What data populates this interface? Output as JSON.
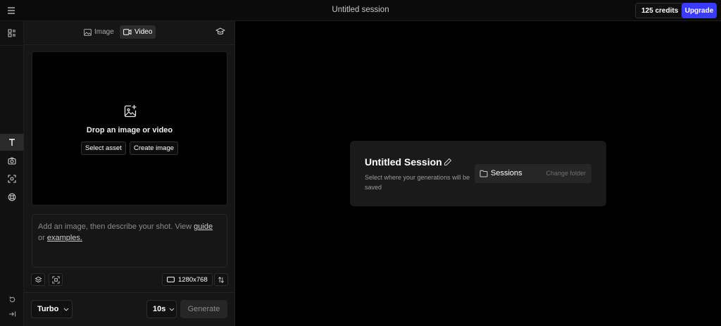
{
  "header": {
    "title": "Untitled session",
    "credits": "125 credits",
    "upgrade_label": "Upgrade"
  },
  "colors": {
    "accent": "#3b3bff"
  },
  "panel": {
    "tabs": [
      {
        "label": "Image",
        "icon": "image-icon",
        "active": false
      },
      {
        "label": "Video",
        "icon": "video-icon",
        "active": true
      }
    ],
    "dropzone": {
      "title": "Drop an image or video",
      "select_asset": "Select asset",
      "create_image": "Create image"
    },
    "prompt": {
      "before": "Add an image, then describe your shot. View ",
      "guide": "guide",
      "middle": " or ",
      "examples": "examples."
    },
    "resolution": "1280x768",
    "model": "Turbo",
    "duration": "10s",
    "generate_label": "Generate"
  },
  "card": {
    "title": "Untitled Session",
    "description": "Select where your generations will be saved",
    "folder_name": "Sessions",
    "change_folder": "Change folder"
  },
  "icons": {
    "rail": [
      "layout-icon",
      "text-icon",
      "camera-icon",
      "scan-face-icon",
      "lifebuoy-icon",
      "rotate-icon",
      "collapse-icon"
    ]
  }
}
